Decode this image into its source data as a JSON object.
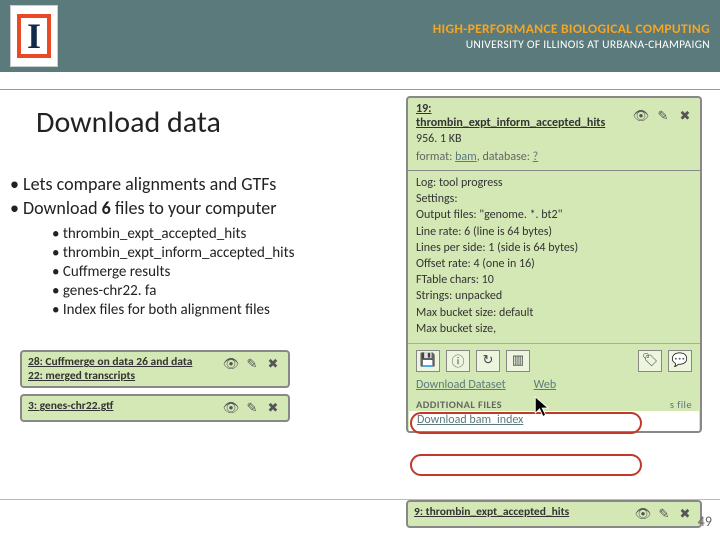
{
  "header": {
    "hpbc": "HIGH-PERFORMANCE BIOLOGICAL COMPUTING",
    "uiuc": "UNIVERSITY OF ILLINOIS AT URBANA-CHAMPAIGN"
  },
  "title": "Download data",
  "main_bullets": [
    "Lets compare alignments and GTFs",
    "Download 6 files to your computer"
  ],
  "bold_token": "6",
  "sub_bullets": [
    "thrombin_expt_accepted_hits",
    "thrombin_expt_inform_accepted_hits",
    "Cuffmerge results",
    "genes-chr22. fa",
    "Index files for both alignment files"
  ],
  "panel": {
    "title": "19: thrombin_expt_inform_accepted_hits",
    "size": "956. 1 KB",
    "format_label": "format:",
    "format_value": "bam",
    "database_label": "database:",
    "database_value": "?",
    "body": [
      "Log: tool progress",
      "Settings:",
      "Output files: \"genome. *. bt2\"",
      "Line rate: 6 (line is 64 bytes)",
      "Lines per side: 1 (side is 64 bytes)",
      "Offset rate: 4 (one in 16)",
      "FTable chars: 10",
      "Strings: unpacked",
      "Max bucket size: default",
      "Max bucket size,"
    ],
    "download_dataset": "Download Dataset",
    "view_web": "Web",
    "additional": "ADDITIONAL FILES",
    "file_hint": "s file",
    "download_index": "Download bam_index"
  },
  "mini_items": {
    "cuffmerge": "28: Cuffmerge on data 26 and data 22: merged transcripts",
    "genes": "3: genes-chr22.gtf",
    "accepted": "9: thrombin_expt_accepted_hits"
  },
  "page_number": "49"
}
